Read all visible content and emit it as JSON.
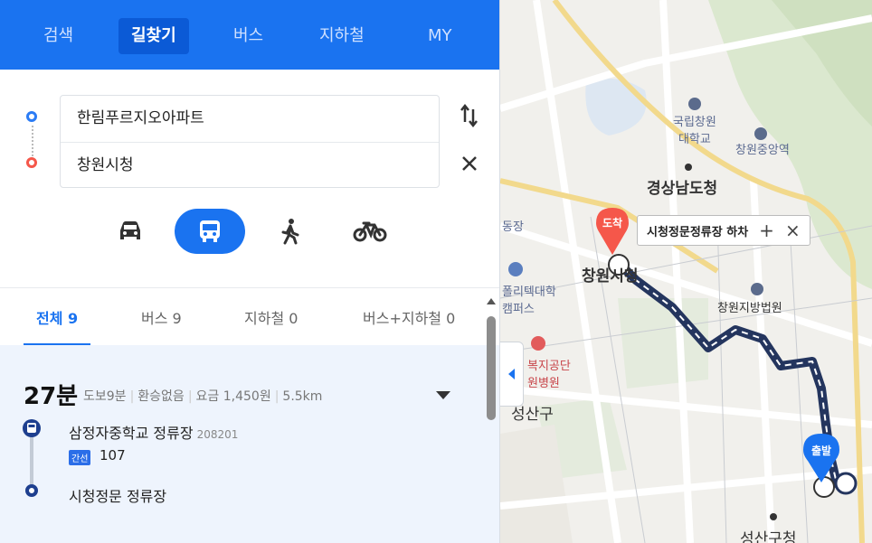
{
  "nav": {
    "tabs": [
      "검색",
      "길찾기",
      "버스",
      "지하철",
      "MY"
    ],
    "active": 1
  },
  "route": {
    "origin": "한림푸르지오아파트",
    "destination": "창원시청"
  },
  "modes": [
    "car",
    "bus",
    "walk",
    "bike"
  ],
  "active_mode": "bus",
  "result_tabs": [
    "전체 9",
    "버스 9",
    "지하철 0",
    "버스+지하철 0"
  ],
  "result": {
    "time": "27분",
    "walk": "도보9분",
    "transfer": "환승없음",
    "fare": "요금 1,450원",
    "distance": "5.5km",
    "board_stop": "삼정자중학교 정류장",
    "board_code": "208201",
    "bus_type": "간선",
    "bus_no": "107",
    "alight_stop": "시청정문 정류장"
  },
  "map": {
    "labels": {
      "univ": "국립창원\n대학교",
      "station": "창원중앙역",
      "gov": "경상남도청",
      "cityhall": "창원시청",
      "court": "창원지방법원",
      "poly": "폴리텍대학\n캠퍼스",
      "welfare": "복지공단\n원병원",
      "district": "성산구",
      "seongsan_office": "성산구청",
      "tong": "동장"
    },
    "tooltip": "시청정문정류장 하차",
    "tooltip_plus": "+",
    "tooltip_close": "×",
    "arrival": "도착",
    "departure": "출발",
    "route_color": "#24355e"
  }
}
